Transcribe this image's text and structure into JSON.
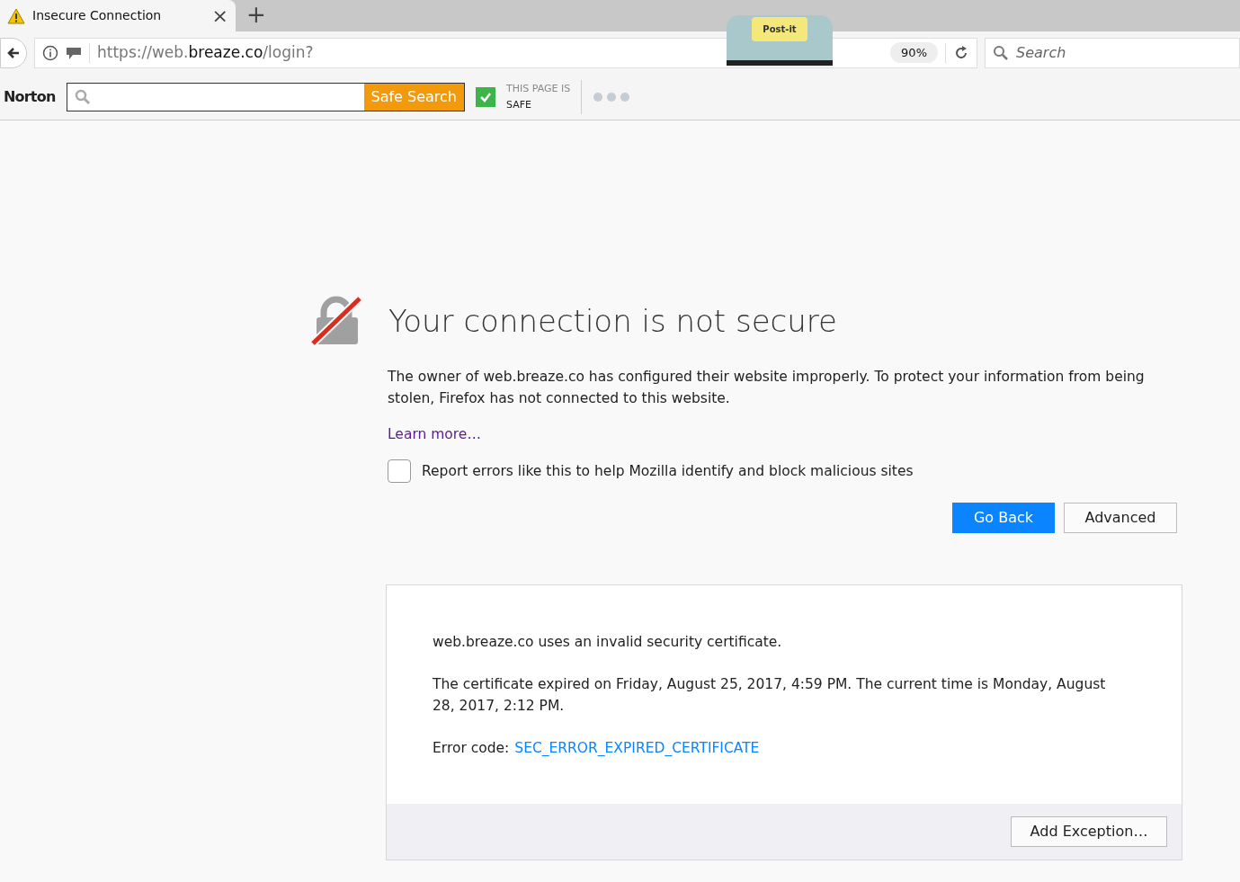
{
  "tabs": [
    {
      "title": "Insecure Connection",
      "selected": true,
      "close": "×"
    }
  ],
  "new_tab": "+",
  "address_bar": {
    "url_parts": [
      {
        "text": "https://web.",
        "kind": "dim"
      },
      {
        "text": "breaze.co",
        "kind": "host"
      },
      {
        "text": "/login?",
        "kind": "dim"
      }
    ],
    "zoom": "90%"
  },
  "postit_logo": "Post-it",
  "search": {
    "placeholder": "Search"
  },
  "norton_bar": {
    "logo": "Norton",
    "button": "Safe Search",
    "status_line_1": "THIS PAGE IS",
    "status_line_2": "SAFE",
    "safe": true
  },
  "error": {
    "title": "Your connection is not secure",
    "description": "The owner of web.breaze.co has configured their website improperly. To protect your information from being stolen, Firefox has not connected to this website.",
    "learn_more": "Learn more…",
    "report": {
      "label": "Report errors like this to help Mozilla identify and block malicious sites",
      "checked": false
    },
    "buttons": [
      {
        "label": "Go Back",
        "kind": "primary"
      },
      {
        "label": "Advanced",
        "kind": "secondary"
      }
    ]
  },
  "advanced": {
    "summary": "web.breaze.co uses an invalid security certificate.",
    "details": "The certificate expired on Friday, August 25, 2017, 4:59 PM. The current time is Monday, August 28, 2017, 2:12 PM.",
    "error_code_label": "Error code:",
    "error_code": "SEC_ERROR_EXPIRED_CERTIFICATE",
    "button": "Add Exception…"
  }
}
